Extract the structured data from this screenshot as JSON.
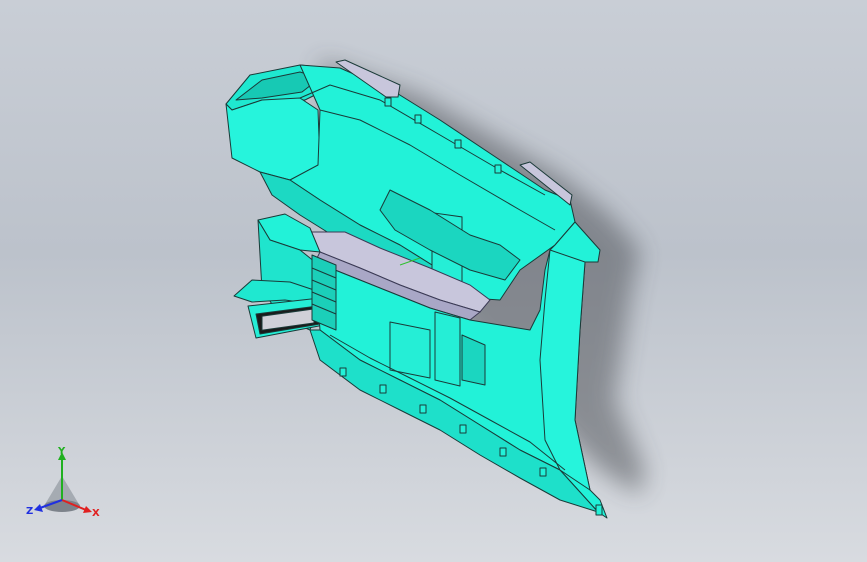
{
  "viewport": {
    "background_top": "#c9ced6",
    "background_bottom": "#d8dbe0"
  },
  "model": {
    "part_color": "#22f2d8",
    "edge_color": "#1a3a38",
    "insert_color": "#c8c6dc",
    "icon": "cad-part-icon"
  },
  "triad": {
    "x_label": "X",
    "y_label": "Y",
    "z_label": "Z",
    "x_color": "#e02020",
    "y_color": "#20b020",
    "z_color": "#2030e0"
  }
}
